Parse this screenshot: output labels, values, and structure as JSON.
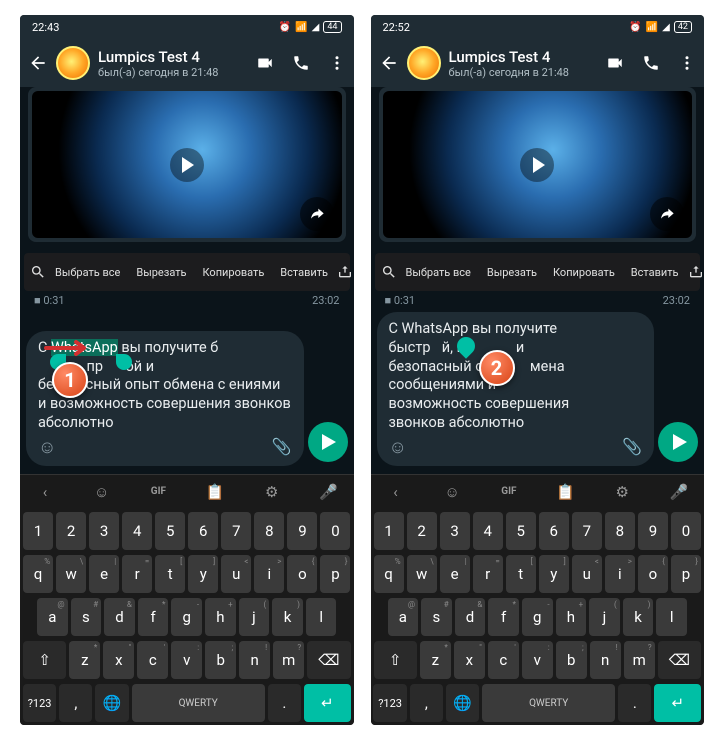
{
  "screens": [
    {
      "status": {
        "time": "22:43",
        "battery": "44"
      },
      "header": {
        "name": "Lumpics Test 4",
        "status": "был(-а) сегодня в 21:48"
      },
      "context_menu": {
        "select_all": "Выбрать все",
        "cut": "Вырезать",
        "copy": "Копировать",
        "paste": "Вставить"
      },
      "video_meta": {
        "duration": "0:31",
        "time": "23:02"
      },
      "input": {
        "prefix": "С ",
        "highlighted": "WhatsApp",
        "suffix": " вы получите б",
        "line2_mid": ", пр",
        "line2_end": "ой и",
        "rest": "безопасный опыт обмена с              ениями и возможность совершения звонков абсолютно"
      },
      "badge": "1"
    },
    {
      "status": {
        "time": "22:52",
        "battery": "42"
      },
      "header": {
        "name": "Lumpics Test 4",
        "status": "был(-а) сегодня в 21:48"
      },
      "context_menu": {
        "select_all": "Выбрать все",
        "cut": "Вырезать",
        "copy": "Копировать",
        "paste": "Вставить"
      },
      "video_meta": {
        "duration": "0:31",
        "time": "23:02"
      },
      "input": {
        "line1": "С WhatsApp вы получите",
        "line2a": "быстр",
        "line2b": "й, пр",
        "line2c": "и",
        "line3a": "безопасный о",
        "line3b": "мена",
        "line4": "сообщениями и",
        "line5": "возможность совершения",
        "line6": "звонков абсолютно"
      },
      "badge": "2"
    }
  ],
  "keyboard": {
    "space_label": "QWERTY",
    "sym_label": "?123",
    "row1": [
      "1",
      "2",
      "3",
      "4",
      "5",
      "6",
      "7",
      "8",
      "9",
      "0"
    ],
    "row2": [
      {
        "k": "q",
        "s": "%"
      },
      {
        "k": "w",
        "s": "\\"
      },
      {
        "k": "e",
        "s": "|"
      },
      {
        "k": "r",
        "s": "="
      },
      {
        "k": "t",
        "s": "["
      },
      {
        "k": "y",
        "s": "]"
      },
      {
        "k": "u",
        "s": "<"
      },
      {
        "k": "i",
        "s": ">"
      },
      {
        "k": "o",
        "s": "{"
      },
      {
        "k": "p",
        "s": "}"
      }
    ],
    "row3": [
      {
        "k": "a",
        "s": "@"
      },
      {
        "k": "s",
        "s": "#"
      },
      {
        "k": "d",
        "s": "&"
      },
      {
        "k": "f",
        "s": "*"
      },
      {
        "k": "g",
        "s": "-"
      },
      {
        "k": "h",
        "s": "+"
      },
      {
        "k": "j",
        "s": "("
      },
      {
        "k": "k",
        "s": ")"
      },
      {
        "k": "l",
        "s": ""
      }
    ],
    "row4": [
      {
        "k": "z",
        "s": "*"
      },
      {
        "k": "x",
        "s": "\""
      },
      {
        "k": "c",
        "s": "'"
      },
      {
        "k": "v",
        "s": ":"
      },
      {
        "k": "b",
        "s": ";"
      },
      {
        "k": "n",
        "s": "!"
      },
      {
        "k": "m",
        "s": "?"
      }
    ]
  }
}
